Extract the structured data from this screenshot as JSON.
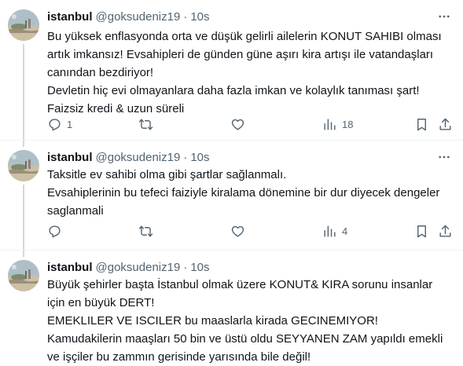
{
  "tweets": [
    {
      "author_name": "istanbul",
      "handle": "@goksudeniz19",
      "separator": "·",
      "time": "10s",
      "text": "Bu yüksek enflasyonda orta ve düşük gelirli ailelerin KONUT SAHIBI olması artık imkansız! Evsahipleri de günden güne aşırı kira artışı ile vatandaşları canından bezdiriyor!\nDevletin hiç evi olmayanlara daha fazla imkan ve kolaylık  tanıması şart!\nFaizsiz kredi & uzun süreli",
      "reply_count": "1",
      "retweet_count": "",
      "like_count": "",
      "view_count": "18"
    },
    {
      "author_name": "istanbul",
      "handle": "@goksudeniz19",
      "separator": "·",
      "time": "10s",
      "text": "Taksitle ev sahibi olma gibi şartlar sağlanmalı.\nEvsahiplerinin bu tefeci faiziyle kiralama dönemine bir dur diyecek dengeler saglanmali",
      "reply_count": "",
      "retweet_count": "",
      "like_count": "",
      "view_count": "4"
    },
    {
      "author_name": "istanbul",
      "handle": "@goksudeniz19",
      "separator": "·",
      "time": "10s",
      "text": "Büyük şehirler başta İstanbul olmak üzere KONUT& KIRA sorunu insanlar için en büyük DERT!\nEMEKLILER VE ISCILER bu maaslarla kirada GECINEMIYOR!\nKamudakilerin maaşları 50 bin ve üstü oldu SEYYANEN ZAM yapıldı emekli ve işçiler bu zammın gerisinde yarısında bile değil!"
    }
  ],
  "icons": {
    "more": "more-horizontal-icon",
    "reply": "reply-icon",
    "retweet": "retweet-icon",
    "like": "heart-icon",
    "views": "views-chart-icon",
    "bookmark": "bookmark-icon",
    "share": "share-icon"
  },
  "colors": {
    "text_primary": "#0f1419",
    "text_secondary": "#536471",
    "divider": "#eff3f4",
    "thread_line": "#cfd9de"
  }
}
